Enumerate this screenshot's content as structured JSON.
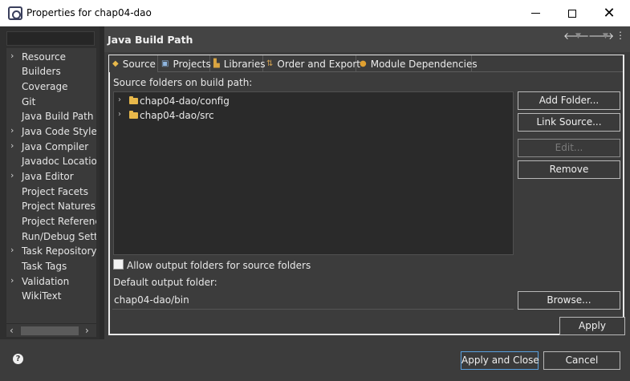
{
  "window": {
    "title": "Properties for chap04-dao"
  },
  "nav": {
    "items": [
      {
        "label": "Resource",
        "expandable": true
      },
      {
        "label": "Builders",
        "expandable": false
      },
      {
        "label": "Coverage",
        "expandable": false
      },
      {
        "label": "Git",
        "expandable": false
      },
      {
        "label": "Java Build Path",
        "expandable": false
      },
      {
        "label": "Java Code Style",
        "expandable": true
      },
      {
        "label": "Java Compiler",
        "expandable": true
      },
      {
        "label": "Javadoc Location",
        "expandable": false
      },
      {
        "label": "Java Editor",
        "expandable": true
      },
      {
        "label": "Project Facets",
        "expandable": false
      },
      {
        "label": "Project Natures",
        "expandable": false
      },
      {
        "label": "Project References",
        "expandable": false
      },
      {
        "label": "Run/Debug Settings",
        "expandable": false
      },
      {
        "label": "Task Repository",
        "expandable": true
      },
      {
        "label": "Task Tags",
        "expandable": false
      },
      {
        "label": "Validation",
        "expandable": true
      },
      {
        "label": "WikiText",
        "expandable": false
      }
    ]
  },
  "page": {
    "title": "Java Build Path",
    "tabs": [
      {
        "label": "Source",
        "icon": "source-icon",
        "active": true
      },
      {
        "label": "Projects",
        "icon": "projects-icon",
        "active": false
      },
      {
        "label": "Libraries",
        "icon": "libraries-icon",
        "active": false
      },
      {
        "label": "Order and Export",
        "icon": "order-export-icon",
        "active": false
      },
      {
        "label": "Module Dependencies",
        "icon": "module-icon",
        "active": false
      }
    ],
    "source_folders_label": "Source folders on build path:",
    "source_folders": [
      {
        "label": "chap04-dao/config"
      },
      {
        "label": "chap04-dao/src"
      }
    ],
    "buttons": {
      "add_folder": "Add Folder...",
      "link_source": "Link Source...",
      "edit": "Edit...",
      "remove": "Remove",
      "browse": "Browse..."
    },
    "allow_output_label": "Allow output folders for source folders",
    "allow_output_checked": false,
    "default_output_label": "Default output folder:",
    "default_output_value": "chap04-dao/bin",
    "apply": "Apply"
  },
  "footer": {
    "apply_close": "Apply and Close",
    "cancel": "Cancel"
  }
}
